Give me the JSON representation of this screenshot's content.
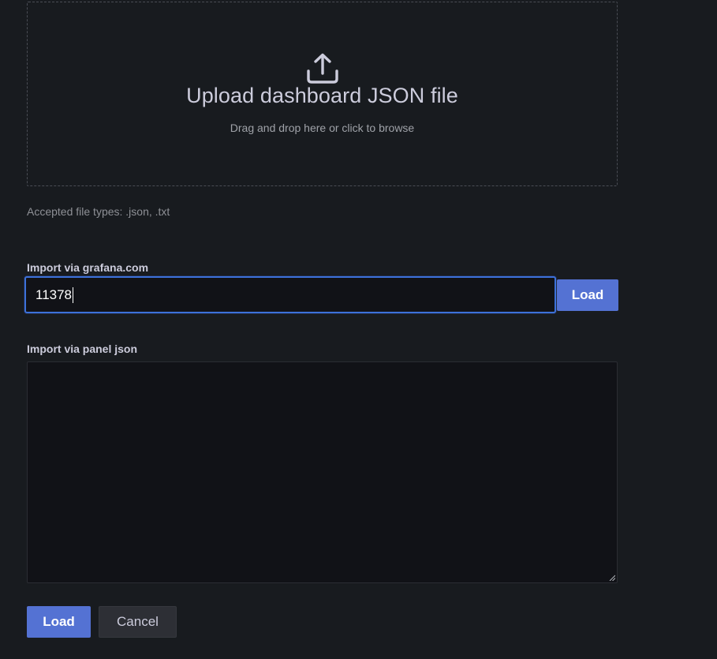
{
  "upload": {
    "icon": "upload-icon",
    "title": "Upload dashboard JSON file",
    "subtitle": "Drag and drop here or click to browse",
    "accepted_types": "Accepted file types: .json, .txt"
  },
  "grafana_import": {
    "label": "Import via grafana.com",
    "value": "11378",
    "load_label": "Load"
  },
  "panel_json": {
    "label": "Import via panel json",
    "value": ""
  },
  "actions": {
    "load_label": "Load",
    "cancel_label": "Cancel"
  },
  "colors": {
    "background": "#181b1f",
    "input_background": "#111217",
    "primary": "#5472d3",
    "focus_border": "#3d71d9",
    "secondary_button": "#2d2f35"
  }
}
